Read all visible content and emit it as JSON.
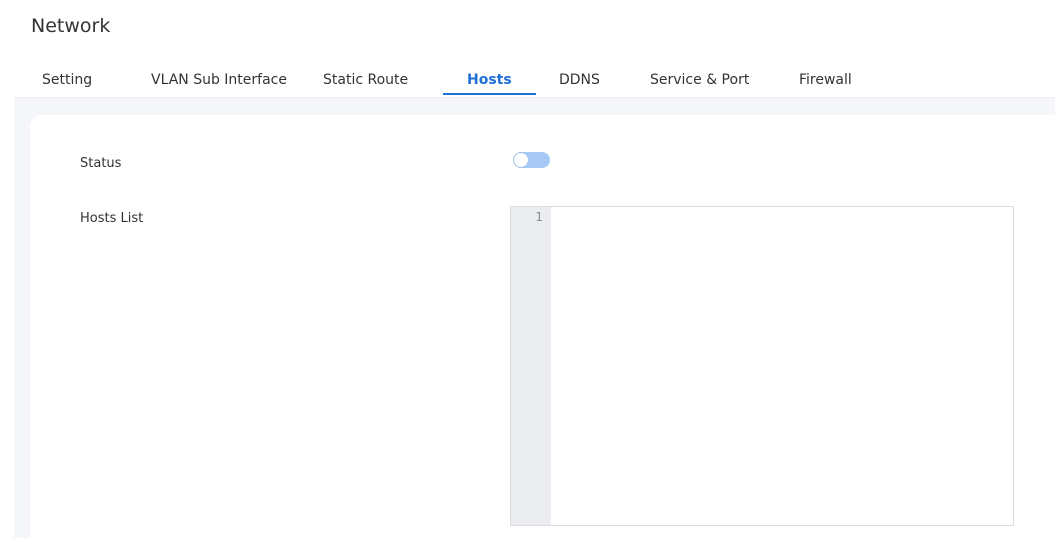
{
  "header": {
    "title": "Network"
  },
  "tabs": [
    {
      "label": "Setting",
      "active": false
    },
    {
      "label": "VLAN Sub Interface",
      "active": false
    },
    {
      "label": "Static Route",
      "active": false
    },
    {
      "label": "Hosts",
      "active": true
    },
    {
      "label": "DDNS",
      "active": false
    },
    {
      "label": "Service & Port",
      "active": false
    },
    {
      "label": "Firewall",
      "active": false
    }
  ],
  "form": {
    "status_label": "Status",
    "status_enabled": false,
    "hosts_list_label": "Hosts List",
    "hosts_list_value": "",
    "line_numbers": [
      "1"
    ]
  },
  "colors": {
    "accent": "#1f6fd8",
    "toggle_off": "#a6c8f5",
    "content_background": "#f5f6f9",
    "gutter": "#ebedf1"
  },
  "icons": {
    "status_toggle": "toggle-switch-icon"
  }
}
